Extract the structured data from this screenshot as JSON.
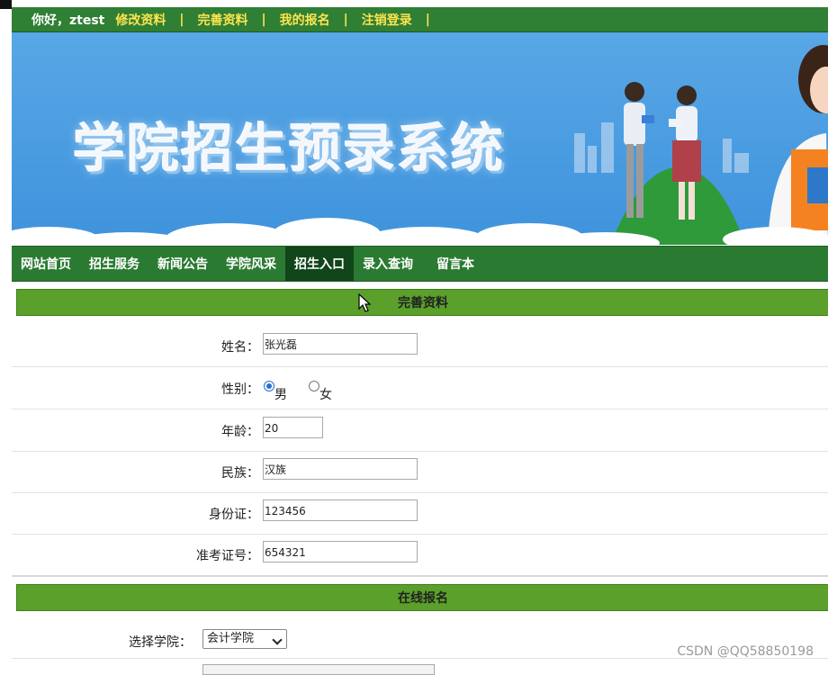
{
  "userbar": {
    "greeting": "你好，ztest",
    "links": [
      "修改资料",
      "完善资料",
      "我的报名",
      "注销登录"
    ],
    "separator": "|"
  },
  "banner": {
    "title": "学院招生预录系统"
  },
  "nav": {
    "items": [
      "网站首页",
      "招生服务",
      "新闻公告",
      "学院风采",
      "招生入口",
      "录入查询",
      "留言本"
    ],
    "active_index": 4
  },
  "profile": {
    "header": "完善资料",
    "name_label": "姓名：",
    "name_value": "张光磊",
    "gender_label": "性别：",
    "gender_options": [
      "男",
      "女"
    ],
    "gender_selected": "男",
    "age_label": "年龄：",
    "age_value": "20",
    "ethnicity_label": "民族：",
    "ethnicity_value": "汉族",
    "id_label": "身份证：",
    "id_value": "123456",
    "exam_label": "准考证号：",
    "exam_value": "654321"
  },
  "register": {
    "header": "在线报名",
    "college_label": "选择学院：",
    "college_selected": "会计学院"
  },
  "watermark": "CSDN @QQ58850198",
  "colors": {
    "userbar_bg": "#2f7f35",
    "link_yellow": "#ffe44d",
    "nav_bg": "#2b7a32",
    "nav_active": "#11451a",
    "section_green": "#5aa02a",
    "banner_blue": "#4a9de0"
  }
}
